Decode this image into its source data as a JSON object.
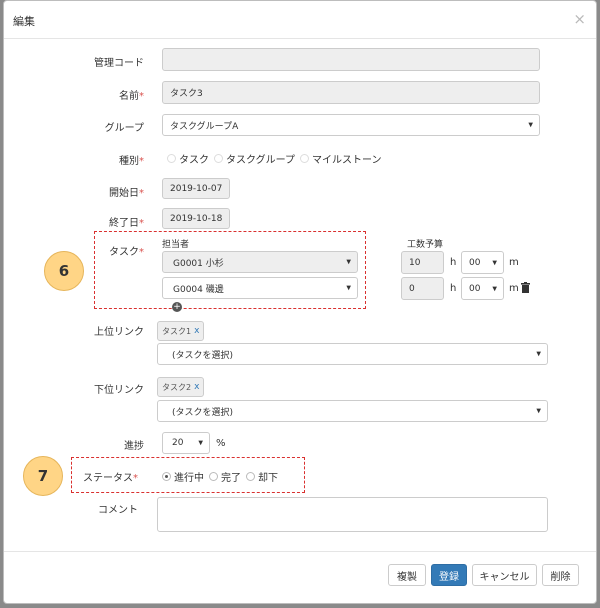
{
  "header": {
    "title": "編集",
    "close": "×"
  },
  "form": {
    "code": {
      "label": "管理コード",
      "value": ""
    },
    "name": {
      "label": "名前",
      "value": "タスク3"
    },
    "group": {
      "label": "グループ",
      "value": "タスクグループA"
    },
    "type": {
      "label": "種別",
      "options": [
        "タスク",
        "タスクグループ",
        "マイルストーン"
      ],
      "selected": 0
    },
    "start": {
      "label": "開始日",
      "value": "2019-10-07"
    },
    "end": {
      "label": "終了日",
      "value": "2019-10-18"
    },
    "task": {
      "label": "タスク",
      "assignee_header": "担当者",
      "budget_header": "工数予算",
      "rows": [
        {
          "assignee": "G0001 小杉",
          "hours": "10",
          "h_unit": "h",
          "minutes": "00",
          "m_unit": "m"
        },
        {
          "assignee": "G0004 磯邊",
          "hours": "0",
          "h_unit": "h",
          "minutes": "00",
          "m_unit": "m"
        }
      ]
    },
    "upper_link": {
      "label": "上位リンク",
      "tag": "タスク1",
      "tag_x": "x",
      "select": "(タスクを選択)"
    },
    "lower_link": {
      "label": "下位リンク",
      "tag": "タスク2",
      "tag_x": "x",
      "select": "(タスクを選択)"
    },
    "progress": {
      "label": "進捗",
      "value": "20",
      "unit": "%"
    },
    "status": {
      "label": "ステータス",
      "options": [
        "進行中",
        "完了",
        "却下"
      ],
      "selected": 0
    },
    "comment": {
      "label": "コメント",
      "value": ""
    }
  },
  "badges": {
    "b6": "6",
    "b7": "7"
  },
  "footer": {
    "copy": "複製",
    "save": "登録",
    "cancel": "キャンセル",
    "delete": "削除"
  },
  "colors": {
    "primary": "#337ab7",
    "required": "#d9534f",
    "callout_border": "#d9302f",
    "badge": "#ffd586"
  }
}
